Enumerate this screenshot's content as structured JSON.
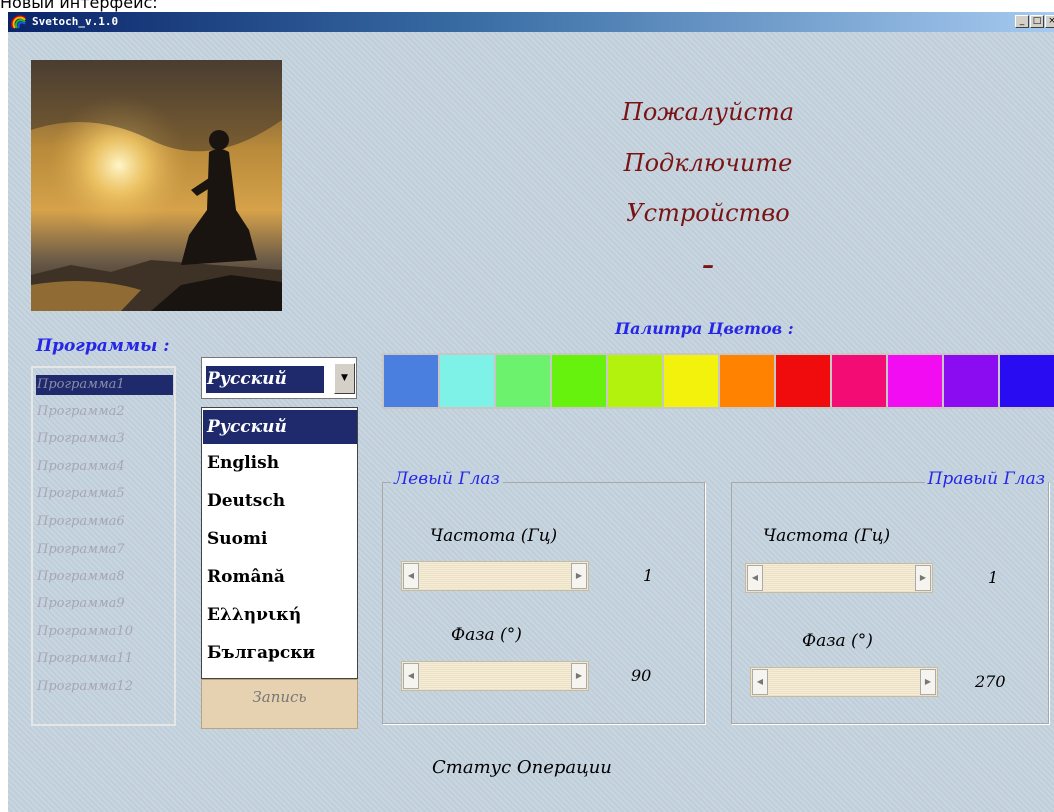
{
  "caption": "Новый интерфейс:",
  "window": {
    "title": "Svetoch_v.1.0",
    "min_glyph": "_",
    "max_glyph": "□",
    "close_glyph": "×"
  },
  "message": {
    "line1": "Пожалуйста",
    "line2": "Подключите",
    "line3": "Устройство",
    "line4": "–"
  },
  "programs": {
    "label": "Программы :",
    "items": [
      "Программа1",
      "Программа2",
      "Программа3",
      "Программа4",
      "Программа5",
      "Программа6",
      "Программа7",
      "Программа8",
      "Программа9",
      "Программа10",
      "Программа11",
      "Программа12"
    ],
    "selected_index": 0
  },
  "language": {
    "selected": "Русский",
    "arrow_glyph": "▼",
    "options": [
      "Русский",
      "English",
      "Deutsch",
      "Suomi",
      "Română",
      "Ελληνική",
      "Български"
    ]
  },
  "record_button": {
    "label": "Запись"
  },
  "palette": {
    "label": "Палитра Цветов :",
    "colors": [
      "#4a7fe0",
      "#7ef2e6",
      "#6cf26c",
      "#66f20c",
      "#b2f20c",
      "#f2f20c",
      "#ff8200",
      "#f00c0c",
      "#f20c74",
      "#f20cf2",
      "#8c0cf2",
      "#2a0cf2"
    ]
  },
  "left_eye": {
    "title": "Левый Глаз",
    "freq_label": "Частота (Гц)",
    "freq_value": "1",
    "phase_label": "Фаза (°)",
    "phase_value": "90"
  },
  "right_eye": {
    "title": "Правый Глаз",
    "freq_label": "Частота (Гц)",
    "freq_value": "1",
    "phase_label": "Фаза (°)",
    "phase_value": "270"
  },
  "status": {
    "text": "Статус Операции"
  }
}
